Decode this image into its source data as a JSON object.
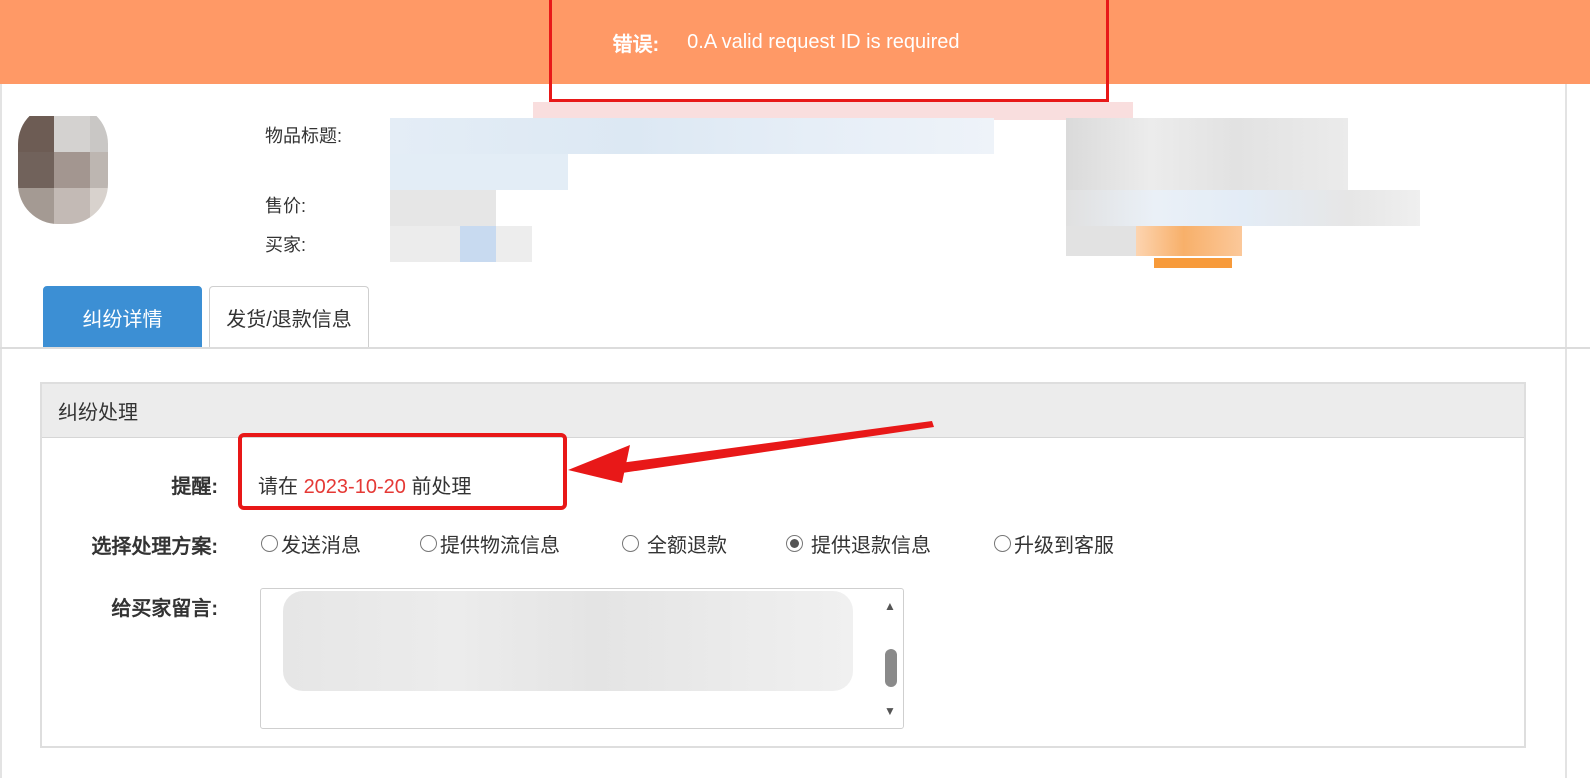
{
  "error_banner": {
    "label": "错误:",
    "message": "0.A valid request ID is required"
  },
  "item_info": {
    "title_label": "物品标题:",
    "price_label": "售价:",
    "buyer_label": "买家:"
  },
  "tabs": [
    {
      "label": "纠纷详情",
      "active": true
    },
    {
      "label": "发货/退款信息",
      "active": false
    }
  ],
  "panel": {
    "title": "纠纷处理",
    "reminder_label": "提醒:",
    "reminder_prefix": "请在",
    "reminder_date": "2023-10-20",
    "reminder_suffix": "前处理",
    "options_label": "选择处理方案:",
    "options": [
      {
        "label": "发送消息",
        "checked": false
      },
      {
        "label": "提供物流信息",
        "checked": false
      },
      {
        "label": "全额退款",
        "checked": false
      },
      {
        "label": "提供退款信息",
        "checked": true
      },
      {
        "label": "升级到客服",
        "checked": false
      }
    ],
    "message_label": "给买家留言:"
  },
  "colors": {
    "banner": "#ff9966",
    "tab_active": "#3c8fd4",
    "annotation": "#e81818",
    "date": "#e53935"
  }
}
